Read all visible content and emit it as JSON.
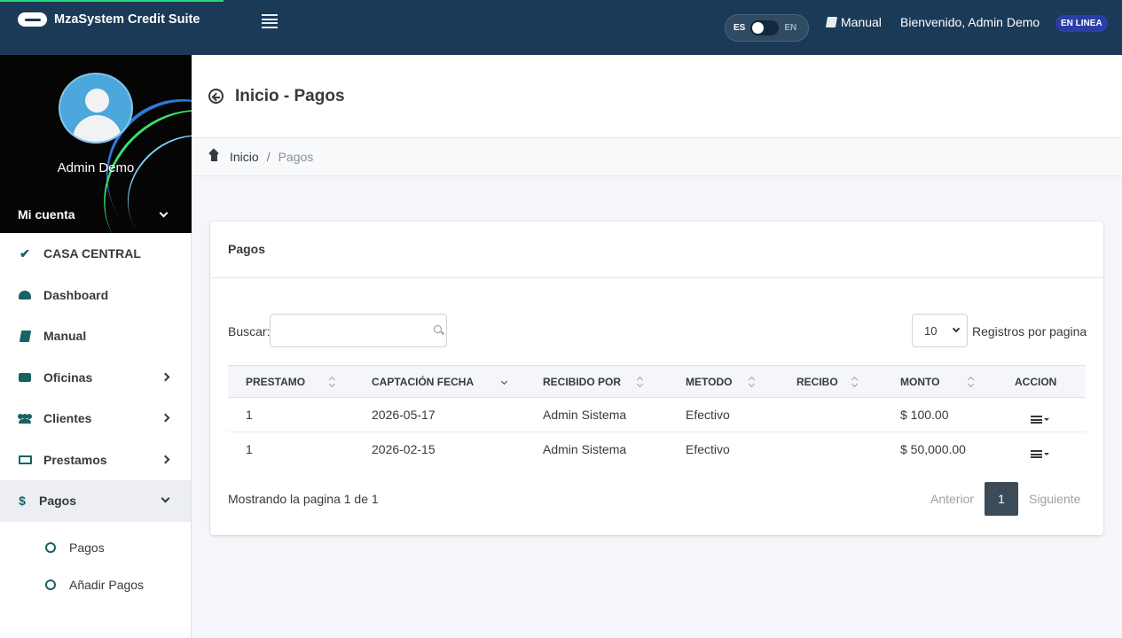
{
  "app": {
    "title": "MzaSystem Credit Suite"
  },
  "topbar": {
    "lang_es": "ES",
    "lang_en": "EN",
    "manual_label": "Manual",
    "welcome": "Bienvenido, Admin Demo",
    "status_badge": "EN LINEA"
  },
  "sidebar": {
    "username": "Admin Demo",
    "account_label": "Mi cuenta",
    "items": [
      {
        "label": "CASA CENTRAL",
        "icon": "check-icon"
      },
      {
        "label": "Dashboard",
        "icon": "dashboard-icon"
      },
      {
        "label": "Manual",
        "icon": "book-icon"
      },
      {
        "label": "Oficinas",
        "icon": "briefcase-icon"
      },
      {
        "label": "Clientes",
        "icon": "users-icon"
      },
      {
        "label": "Prestamos",
        "icon": "money-bill-icon"
      },
      {
        "label": "Pagos",
        "icon": "dollar-icon",
        "glyph": "$"
      }
    ],
    "subitems": [
      {
        "label": "Pagos"
      },
      {
        "label": "Añadir Pagos"
      }
    ]
  },
  "header": {
    "title": "Inicio - Pagos"
  },
  "breadcrumb": {
    "home": "Inicio",
    "separator": "/",
    "current": "Pagos"
  },
  "card": {
    "title": "Pagos",
    "search_label": "Buscar:",
    "page_size": "10",
    "page_size_label": "Registros por pagina",
    "columns": [
      "PRESTAMO",
      "CAPTACIÓN FECHA",
      "RECIBIDO POR",
      "METODO",
      "RECIBO",
      "MONTO",
      "ACCION"
    ],
    "rows": [
      {
        "prestamo": "1",
        "fecha": "2026-05-17",
        "recibido": "Admin Sistema",
        "metodo": "Efectivo",
        "recibo": "",
        "monto": "$ 100.00"
      },
      {
        "prestamo": "1",
        "fecha": "2026-02-15",
        "recibido": "Admin Sistema",
        "metodo": "Efectivo",
        "recibo": "",
        "monto": "$ 50,000.00"
      }
    ],
    "showing": "Mostrando la pagina 1 de 1",
    "pager": {
      "prev": "Anterior",
      "current": "1",
      "next": "Siguiente"
    }
  },
  "colors": {
    "navbar": "#1b3a57",
    "accent": "#176366",
    "badge": "#2b3ea7"
  }
}
